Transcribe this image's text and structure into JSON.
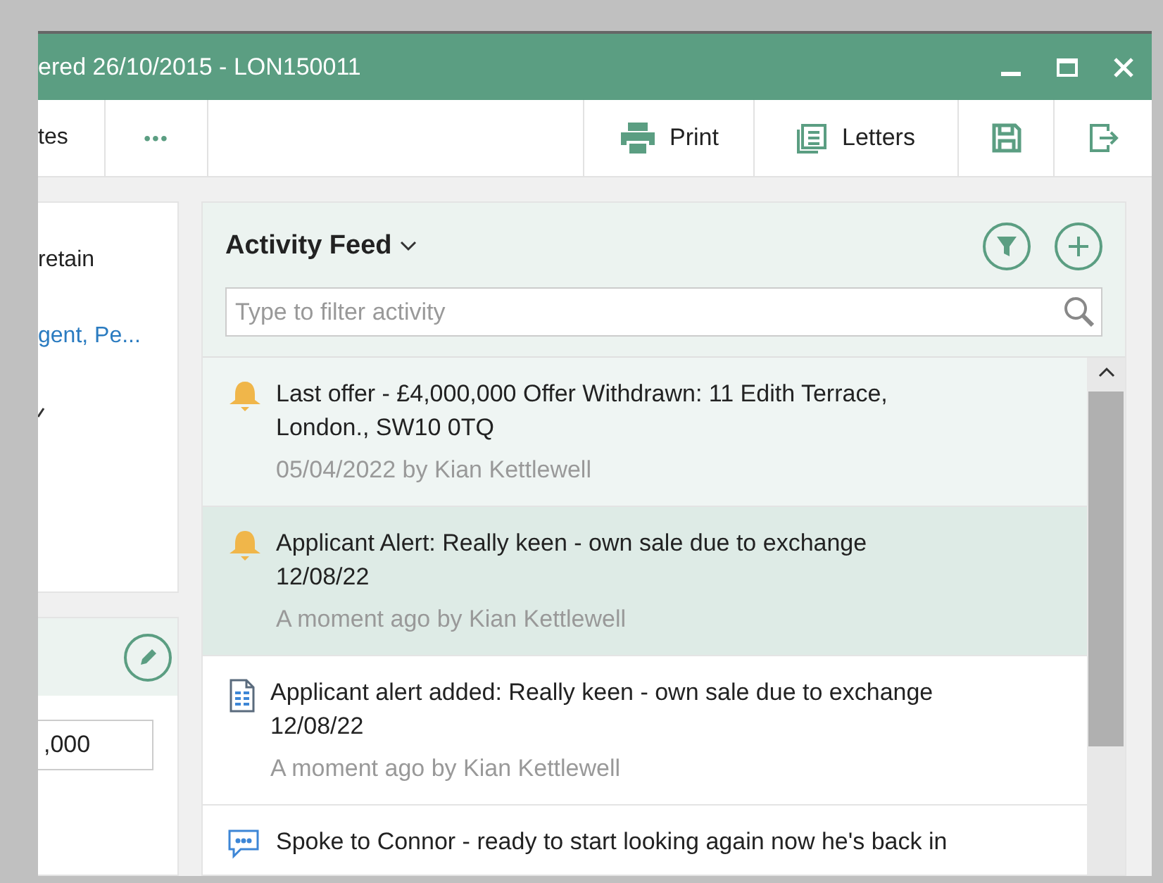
{
  "window": {
    "title": "ered 26/10/2015 - LON150011"
  },
  "toolbar": {
    "tabs": [
      {
        "label": "tes",
        "selected": false
      }
    ],
    "more": "•••",
    "actions": [
      {
        "kind": "print",
        "label": "Print"
      },
      {
        "kind": "letters",
        "label": "Letters"
      },
      {
        "kind": "save"
      },
      {
        "kind": "exit"
      }
    ]
  },
  "left_panel": {
    "rows": [
      {
        "kind": "text",
        "text": "retain"
      },
      {
        "kind": "link",
        "text": "gent, Pe..."
      },
      {
        "kind": "caret"
      }
    ],
    "card": {
      "field_value": ",000"
    }
  },
  "activity_feed": {
    "title": "Activity Feed",
    "search": {
      "placeholder": "Type to filter activity"
    },
    "items": [
      {
        "kind": "alert",
        "unread": true,
        "selected": false,
        "text": "Last offer - £4,000,000 Offer Withdrawn: 11 Edith Terrace, London., SW10 0TQ",
        "meta": "05/04/2022 by Kian Kettlewell"
      },
      {
        "kind": "alert",
        "unread": false,
        "selected": true,
        "text": "Applicant Alert: Really keen - own sale due to exchange 12/08/22",
        "meta": "A moment ago by Kian Kettlewell"
      },
      {
        "kind": "document",
        "unread": false,
        "selected": false,
        "text": "Applicant alert added: Really keen - own sale due to exchange 12/08/22",
        "meta": "A moment ago by Kian Kettlewell"
      },
      {
        "kind": "message",
        "unread": false,
        "selected": false,
        "text": "Spoke to Connor - ready to start looking again now he's back in"
      }
    ]
  }
}
